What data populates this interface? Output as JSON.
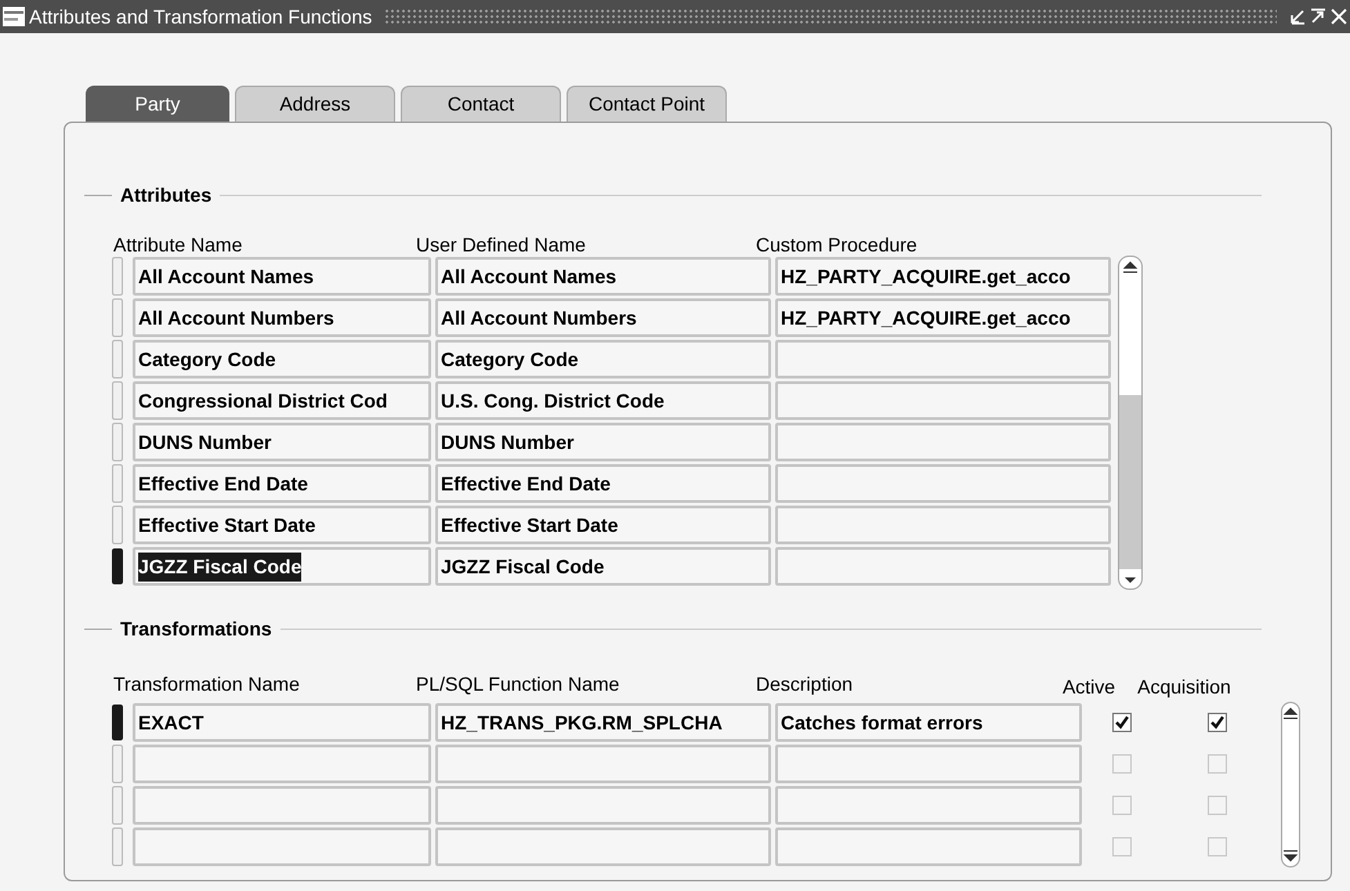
{
  "window": {
    "title": "Attributes and Transformation Functions"
  },
  "tabs": [
    {
      "label": "Party",
      "selected": true
    },
    {
      "label": "Address",
      "selected": false
    },
    {
      "label": "Contact",
      "selected": false
    },
    {
      "label": "Contact Point",
      "selected": false
    }
  ],
  "attributes": {
    "heading": "Attributes",
    "columns": [
      "Attribute Name",
      "User Defined Name",
      "Custom Procedure"
    ],
    "rows": [
      {
        "attribute_name": "All Account Names",
        "user_defined_name": "All Account Names",
        "custom_procedure": "HZ_PARTY_ACQUIRE.get_acco",
        "selected": false,
        "name_highlighted": false
      },
      {
        "attribute_name": "All Account Numbers",
        "user_defined_name": "All Account Numbers",
        "custom_procedure": "HZ_PARTY_ACQUIRE.get_acco",
        "selected": false,
        "name_highlighted": false
      },
      {
        "attribute_name": "Category Code",
        "user_defined_name": "Category Code",
        "selected": false,
        "name_highlighted": false
      },
      {
        "attribute_name": "Congressional District Cod",
        "user_defined_name": "U.S. Cong. District Code",
        "selected": false,
        "name_highlighted": false
      },
      {
        "attribute_name": "DUNS Number",
        "user_defined_name": "DUNS Number",
        "selected": false,
        "name_highlighted": false
      },
      {
        "attribute_name": "Effective End Date",
        "user_defined_name": "Effective End Date",
        "selected": false,
        "name_highlighted": false
      },
      {
        "attribute_name": "Effective Start Date",
        "user_defined_name": "Effective Start Date",
        "selected": false,
        "name_highlighted": false
      },
      {
        "attribute_name": "JGZZ Fiscal Code",
        "user_defined_name": "JGZZ Fiscal Code",
        "selected": true,
        "name_highlighted": true
      }
    ]
  },
  "transformations": {
    "heading": "Transformations",
    "columns": [
      "Transformation Name",
      "PL/SQL Function Name",
      "Description",
      "Active",
      "Acquisition"
    ],
    "rows": [
      {
        "transformation_name": "EXACT",
        "function_name": "HZ_TRANS_PKG.RM_SPLCHA",
        "description": "Catches format errors",
        "active": true,
        "acquisition": true,
        "selected": true
      },
      {
        "active": false,
        "acquisition": false,
        "selected": false
      },
      {
        "active": false,
        "acquisition": false,
        "selected": false
      },
      {
        "active": false,
        "acquisition": false,
        "selected": false
      }
    ]
  }
}
